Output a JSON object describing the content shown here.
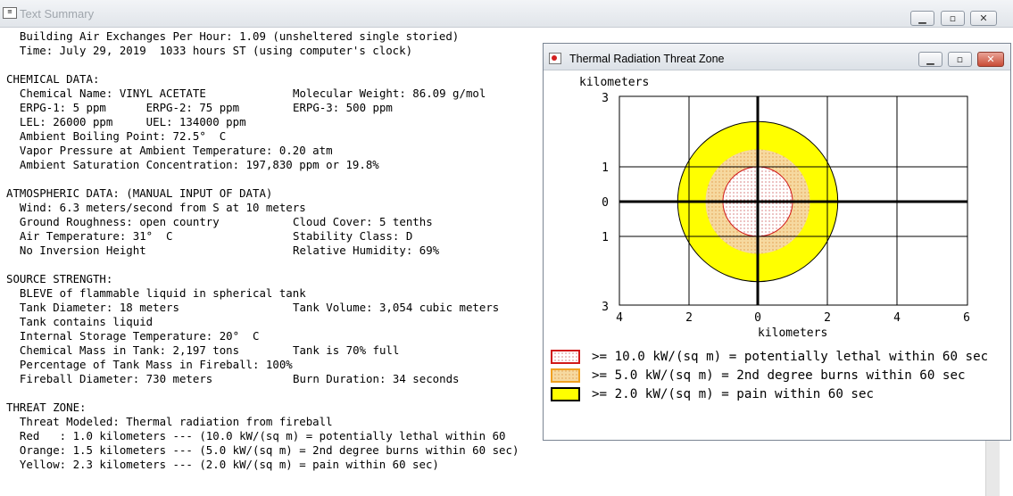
{
  "main_window": {
    "title": "Text Summary",
    "lines": [
      [
        "  Building Air Exchanges Per Hour: 1.09 (unsheltered single storied)"
      ],
      [
        "  Time: July 29, 2019  1033 hours ST (using computer's clock)"
      ],
      [
        ""
      ],
      [
        "CHEMICAL DATA:"
      ],
      [
        "  Chemical Name: VINYL ACETATE",
        "Molecular Weight: 86.09 g/mol"
      ],
      [
        "  ERPG-1: 5 ppm      ERPG-2: 75 ppm",
        "ERPG-3: 500 ppm"
      ],
      [
        "  LEL: 26000 ppm     UEL: 134000 ppm"
      ],
      [
        "  Ambient Boiling Point: 72.5°  C"
      ],
      [
        "  Vapor Pressure at Ambient Temperature: 0.20 atm"
      ],
      [
        "  Ambient Saturation Concentration: 197,830 ppm or 19.8%"
      ],
      [
        ""
      ],
      [
        "ATMOSPHERIC DATA: (MANUAL INPUT OF DATA)"
      ],
      [
        "  Wind: 6.3 meters/second from S at 10 meters"
      ],
      [
        "  Ground Roughness: open country",
        "Cloud Cover: 5 tenths"
      ],
      [
        "  Air Temperature: 31°  C",
        "Stability Class: D"
      ],
      [
        "  No Inversion Height",
        "Relative Humidity: 69%"
      ],
      [
        ""
      ],
      [
        "SOURCE STRENGTH:"
      ],
      [
        "  BLEVE of flammable liquid in spherical tank"
      ],
      [
        "  Tank Diameter: 18 meters",
        "Tank Volume: 3,054 cubic meters"
      ],
      [
        "  Tank contains liquid"
      ],
      [
        "  Internal Storage Temperature: 20°  C"
      ],
      [
        "  Chemical Mass in Tank: 2,197 tons",
        "Tank is 70% full"
      ],
      [
        "  Percentage of Tank Mass in Fireball: 100%"
      ],
      [
        "  Fireball Diameter: 730 meters",
        "Burn Duration: 34 seconds"
      ],
      [
        ""
      ],
      [
        "THREAT ZONE:"
      ],
      [
        "  Threat Modeled: Thermal radiation from fireball"
      ],
      [
        "  Red   : 1.0 kilometers --- (10.0 kW/(sq m) = potentially lethal within 60"
      ],
      [
        "  Orange: 1.5 kilometers --- (5.0 kW/(sq m) = 2nd degree burns within 60 sec)"
      ],
      [
        "  Yellow: 2.3 kilometers --- (2.0 kW/(sq m) = pain within 60 sec)"
      ]
    ]
  },
  "thermal_window": {
    "title": "Thermal Radiation Threat Zone",
    "y_axis_label": "kilometers",
    "x_axis_label": "kilometers",
    "y_ticks": [
      "3",
      "1",
      "0",
      "1",
      "3"
    ],
    "x_ticks": [
      "4",
      "2",
      "0",
      "2",
      "4",
      "6"
    ],
    "legend": [
      "&gt;= 10.0 kW/(sq m) = potentially lethal within 60 sec",
      "&gt;= 5.0 kW/(sq m) = 2nd degree burns within 60 sec",
      "&gt;= 2.0 kW/(sq m) = pain within 60 sec"
    ],
    "zones": [
      {
        "name": "red",
        "radius_km": 1.0,
        "fill": "#ffffff",
        "stroke": "#d01818",
        "dots": "#c03030"
      },
      {
        "name": "orange",
        "radius_km": 1.5,
        "fill": "#f6cf8c",
        "stroke": "#f6cf8c",
        "dots": "#e0a050"
      },
      {
        "name": "yellow",
        "radius_km": 2.3,
        "fill": "#ffff00",
        "stroke": "#000000",
        "dots": ""
      }
    ],
    "colors": {
      "red_border": "#d01818",
      "orange_border": "#f0a020",
      "yellow": "#ffff00"
    }
  }
}
